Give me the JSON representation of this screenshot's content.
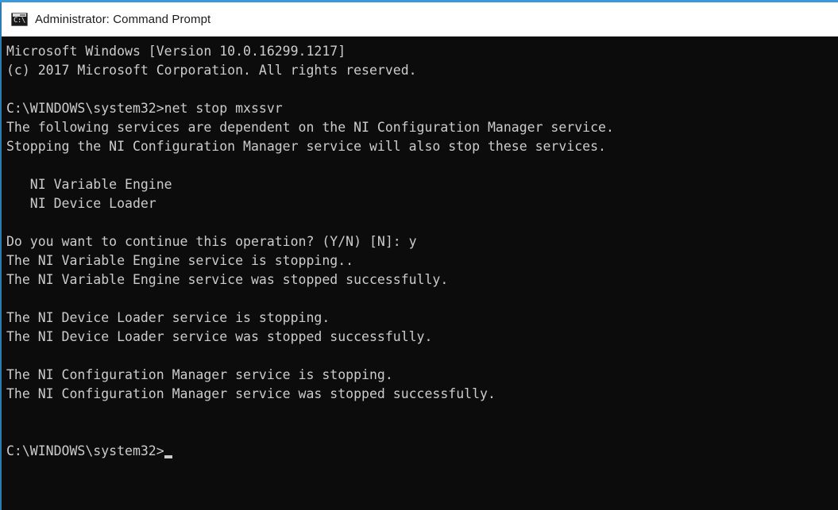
{
  "window": {
    "title": "Administrator: Command Prompt",
    "icon": "command-prompt-icon",
    "icon_text": "C:\\.",
    "accent_color": "#3a9ad9",
    "border_color": "#2d7ab5",
    "titlebar_bg": "#ffffff",
    "titlebar_fg": "#1b1b1b"
  },
  "console": {
    "background_color": "#0c0c0c",
    "foreground_color": "#cccccc",
    "cursor": "_",
    "prompt": "C:\\WINDOWS\\system32>",
    "lines": [
      "Microsoft Windows [Version 10.0.16299.1217]",
      "(c) 2017 Microsoft Corporation. All rights reserved.",
      "",
      "C:\\WINDOWS\\system32>net stop mxssvr",
      "The following services are dependent on the NI Configuration Manager service.",
      "Stopping the NI Configuration Manager service will also stop these services.",
      "",
      "   NI Variable Engine",
      "   NI Device Loader",
      "",
      "Do you want to continue this operation? (Y/N) [N]: y",
      "The NI Variable Engine service is stopping..",
      "The NI Variable Engine service was stopped successfully.",
      "",
      "The NI Device Loader service is stopping.",
      "The NI Device Loader service was stopped successfully.",
      "",
      "The NI Configuration Manager service is stopping.",
      "The NI Configuration Manager service was stopped successfully.",
      "",
      ""
    ],
    "final_prompt": "C:\\WINDOWS\\system32>"
  }
}
